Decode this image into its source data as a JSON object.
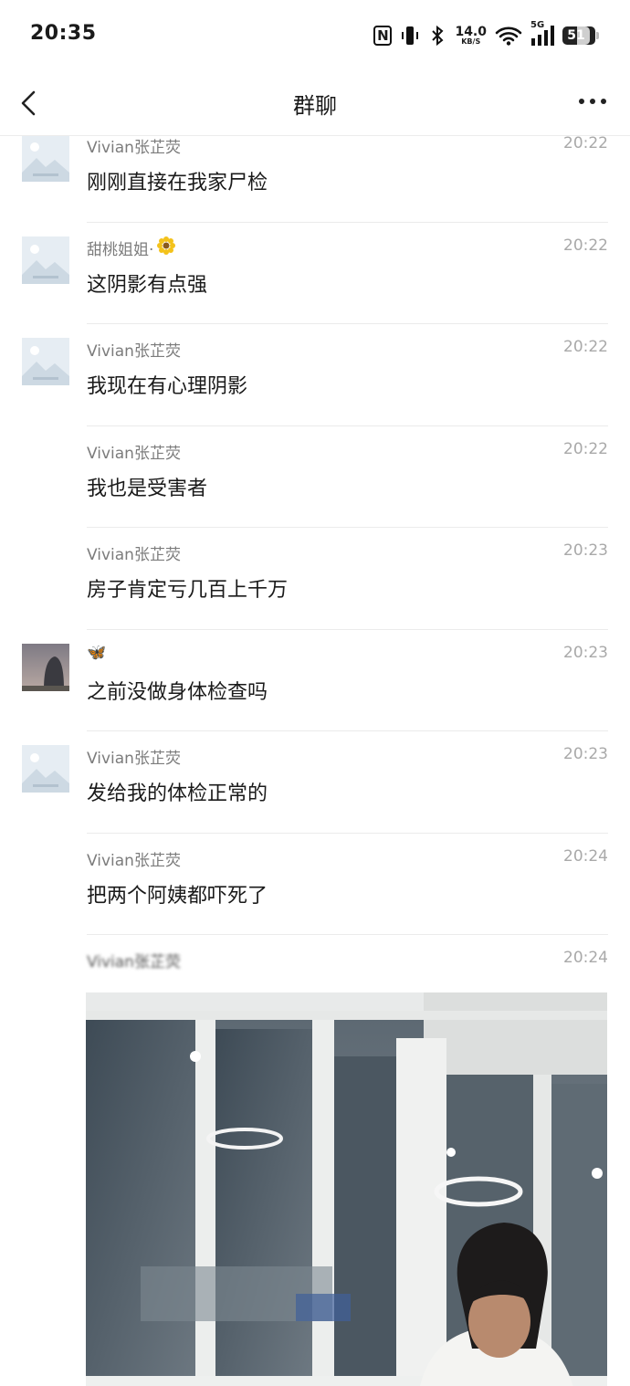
{
  "status_bar": {
    "time": "20:35",
    "net_speed_value": "14.0",
    "net_speed_unit": "KB/S",
    "signal_label": "5G",
    "battery": "51"
  },
  "nav": {
    "title": "群聊"
  },
  "messages": [
    {
      "sender": "Vivian张芷荧",
      "time": "20:22",
      "text": "刚刚直接在我家尸检"
    },
    {
      "sender": "甜桃姐姐·",
      "time": "20:22",
      "text": "这阴影有点强"
    },
    {
      "sender": "Vivian张芷荧",
      "time": "20:22",
      "text": "我现在有心理阴影"
    },
    {
      "sender": "Vivian张芷荧",
      "time": "20:22",
      "text": "我也是受害者"
    },
    {
      "sender": "Vivian张芷荧",
      "time": "20:23",
      "text": "房子肯定亏几百上千万"
    },
    {
      "sender": "🦋",
      "time": "20:23",
      "text": "之前没做身体检查吗"
    },
    {
      "sender": "Vivian张芷荧",
      "time": "20:23",
      "text": "发给我的体检正常的"
    },
    {
      "sender": "Vivian张芷荧",
      "time": "20:24",
      "text": "把两个阿姨都吓死了"
    },
    {
      "sender": "Vivian张芷荧",
      "time": "20:24",
      "text": ""
    }
  ],
  "icons": {
    "back": "chevron-left-icon",
    "more": "more-dots-icon",
    "flower": "sunflower-icon"
  }
}
